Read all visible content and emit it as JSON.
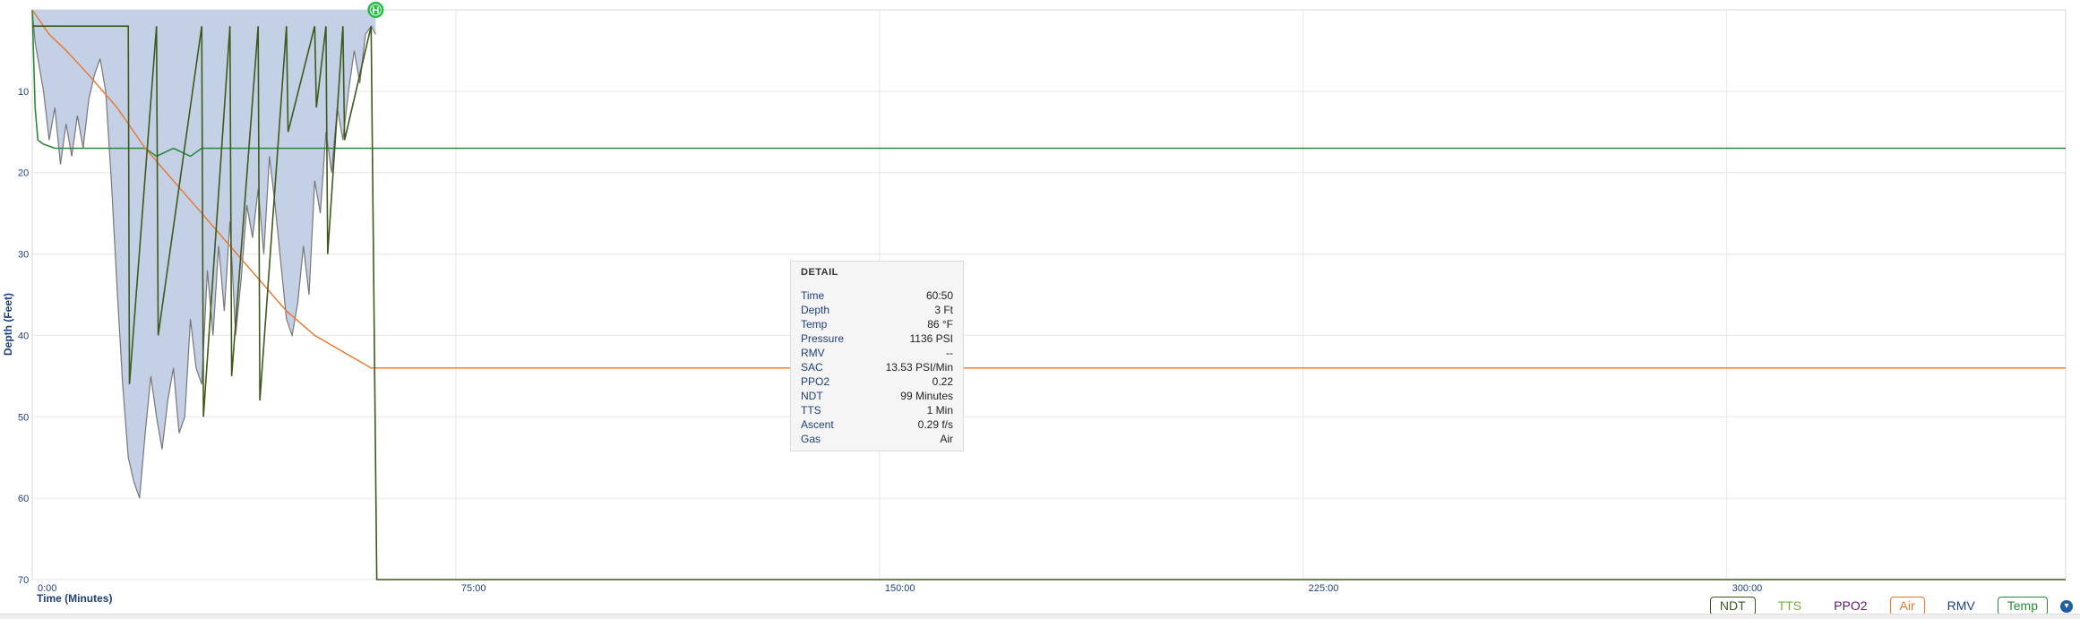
{
  "chart_data": {
    "type": "area",
    "ylabel": "Depth (Feet)",
    "xlabel": "Time (Minutes)",
    "y_ticks": [
      "10",
      "20",
      "30",
      "40",
      "50",
      "60",
      "70"
    ],
    "x_ticks": [
      "0:00",
      "75:00",
      "150:00",
      "225:00",
      "300:00"
    ],
    "y_range": [
      0,
      70
    ],
    "y_inverted": true,
    "x_range_minutes": [
      0,
      360
    ],
    "grid": true,
    "legend_position": "bottom-right",
    "marker_label": "H",
    "series": [
      {
        "name": "Depth",
        "x": [
          0,
          0.5,
          1,
          2,
          3,
          4,
          5,
          6,
          7,
          8,
          9,
          10,
          11,
          12,
          13,
          14,
          15,
          16,
          17,
          18,
          19,
          20,
          21,
          22,
          23,
          24,
          25,
          26,
          27,
          28,
          29,
          30,
          31,
          32,
          33,
          34,
          35,
          36,
          37,
          38,
          39,
          40,
          41,
          42,
          43,
          44,
          45,
          46,
          47,
          48,
          49,
          50,
          51,
          52,
          53,
          54,
          55,
          56,
          57,
          58,
          59,
          60,
          60.8
        ],
        "y": [
          0,
          4,
          6,
          10,
          16,
          12,
          19,
          14,
          18,
          13,
          17,
          11,
          8,
          6,
          10,
          21,
          34,
          46,
          55,
          58,
          60,
          52,
          45,
          50,
          54,
          48,
          44,
          52,
          50,
          38,
          44,
          46,
          32,
          40,
          29,
          37,
          26,
          40,
          33,
          24,
          28,
          22,
          30,
          18,
          24,
          31,
          38,
          40,
          36,
          29,
          35,
          21,
          25,
          15,
          20,
          12,
          16,
          10,
          5,
          9,
          3,
          2,
          3
        ]
      },
      {
        "name": "Temp",
        "x": [
          0,
          0.5,
          1,
          2,
          4,
          6,
          10,
          15,
          20,
          22,
          25,
          28,
          30,
          33,
          35,
          38,
          40,
          45,
          50,
          55,
          60,
          60.8,
          61,
          360
        ],
        "y": [
          0,
          12,
          16,
          16.5,
          17,
          17,
          17,
          17,
          17,
          18,
          17,
          18,
          17,
          17,
          17,
          17,
          17,
          17,
          17,
          17,
          17,
          17,
          17,
          17
        ]
      },
      {
        "name": "Air",
        "x": [
          0,
          1,
          3,
          6,
          10,
          15,
          20,
          25,
          30,
          35,
          40,
          45,
          50,
          55,
          60,
          61,
          360
        ],
        "y": [
          0,
          1,
          3,
          5,
          8,
          12,
          17,
          21,
          25,
          29,
          33,
          37,
          40,
          42,
          44,
          44,
          44
        ]
      },
      {
        "name": "NDT",
        "x": [
          0,
          17,
          17.2,
          22,
          22.3,
          30,
          30.3,
          35,
          35.3,
          40,
          40.3,
          45,
          45.3,
          50,
          50.3,
          52,
          52.3,
          55,
          55.3,
          60,
          61,
          360
        ],
        "y": [
          2,
          2,
          46,
          2,
          40,
          2,
          50,
          2,
          45,
          2,
          48,
          2,
          15,
          2,
          12,
          2,
          30,
          2,
          16,
          2,
          70,
          70
        ]
      }
    ]
  },
  "detail": {
    "title": "DETAIL",
    "rows": [
      {
        "label": "Time",
        "value": "60:50"
      },
      {
        "label": "Depth",
        "value": "3 Ft"
      },
      {
        "label": "Temp",
        "value": "86 °F"
      },
      {
        "label": "Pressure",
        "value": "1136 PSI"
      },
      {
        "label": "RMV",
        "value": "--"
      },
      {
        "label": "SAC",
        "value": "13.53 PSI/Min"
      },
      {
        "label": "PPO2",
        "value": "0.22"
      },
      {
        "label": "NDT",
        "value": "99 Minutes"
      },
      {
        "label": "TTS",
        "value": "1 Min"
      },
      {
        "label": "Ascent",
        "value": "0.29 f/s"
      },
      {
        "label": "Gas",
        "value": "Air"
      }
    ]
  },
  "legend": [
    {
      "label": "NDT",
      "color": "#3d5a1a",
      "boxed": true
    },
    {
      "label": "TTS",
      "color": "#7aa83a",
      "boxed": false
    },
    {
      "label": "PPO2",
      "color": "#5a1a6a",
      "boxed": false
    },
    {
      "label": "Air",
      "color": "#e8762b",
      "boxed": true
    },
    {
      "label": "RMV",
      "color": "#1f3f7a",
      "boxed": false
    },
    {
      "label": "Temp",
      "color": "#2a8a3a",
      "boxed": true
    }
  ],
  "colors": {
    "depth_fill": "#c4d0e6",
    "depth_line": "#777777",
    "temp_line": "#2a8a3a",
    "air_line": "#e8762b",
    "ndt_line": "#3d5a1a",
    "marker": "#22bb44",
    "grid": "#e6e6e6"
  }
}
